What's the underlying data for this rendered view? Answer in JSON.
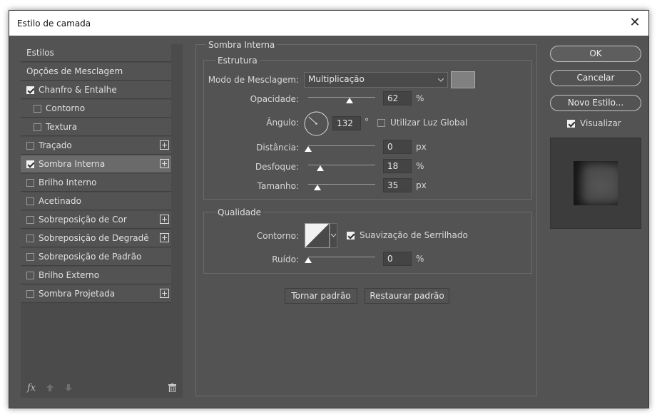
{
  "window": {
    "title": "Estilo de camada",
    "close_symbol": "✕"
  },
  "styles_list": {
    "items": [
      {
        "label": "Estilos",
        "checkbox": false,
        "checked": false,
        "plus": false,
        "indent": false,
        "selected": false
      },
      {
        "label": "Opções de Mesclagem",
        "checkbox": false,
        "checked": false,
        "plus": false,
        "indent": false,
        "selected": false
      },
      {
        "label": "Chanfro & Entalhe",
        "checkbox": true,
        "checked": true,
        "plus": false,
        "indent": false,
        "selected": false
      },
      {
        "label": "Contorno",
        "checkbox": true,
        "checked": false,
        "plus": false,
        "indent": true,
        "selected": false
      },
      {
        "label": "Textura",
        "checkbox": true,
        "checked": false,
        "plus": false,
        "indent": true,
        "selected": false
      },
      {
        "label": "Traçado",
        "checkbox": true,
        "checked": false,
        "plus": true,
        "indent": false,
        "selected": false
      },
      {
        "label": "Sombra Interna",
        "checkbox": true,
        "checked": true,
        "plus": true,
        "indent": false,
        "selected": true
      },
      {
        "label": "Brilho Interno",
        "checkbox": true,
        "checked": false,
        "plus": false,
        "indent": false,
        "selected": false
      },
      {
        "label": "Acetinado",
        "checkbox": true,
        "checked": false,
        "plus": false,
        "indent": false,
        "selected": false
      },
      {
        "label": "Sobreposição de Cor",
        "checkbox": true,
        "checked": false,
        "plus": true,
        "indent": false,
        "selected": false
      },
      {
        "label": "Sobreposição de Degradê",
        "checkbox": true,
        "checked": false,
        "plus": true,
        "indent": false,
        "selected": false
      },
      {
        "label": "Sobreposição de Padrão",
        "checkbox": true,
        "checked": false,
        "plus": false,
        "indent": false,
        "selected": false
      },
      {
        "label": "Brilho Externo",
        "checkbox": true,
        "checked": false,
        "plus": false,
        "indent": false,
        "selected": false
      },
      {
        "label": "Sombra Projetada",
        "checkbox": true,
        "checked": false,
        "plus": true,
        "indent": false,
        "selected": false
      }
    ],
    "footer_icons": [
      "fx-icon",
      "move-up-icon",
      "move-down-icon",
      "trash-icon"
    ],
    "fx_label": "fx"
  },
  "inner_shadow": {
    "title": "Sombra Interna",
    "structure": {
      "title": "Estrutura",
      "blend_mode_label": "Modo de Mesclagem:",
      "blend_mode_value": "Multiplicação",
      "shadow_color": "#808080",
      "opacity_label": "Opacidade:",
      "opacity_value": "62",
      "opacity_unit": "%",
      "angle_label": "Ângulo:",
      "angle_value": "132",
      "angle_unit": "°",
      "use_global_light_label": "Utilizar Luz Global",
      "use_global_light_checked": false,
      "distance_label": "Distância:",
      "distance_value": "0",
      "distance_unit": "px",
      "choke_label": "Desfoque:",
      "choke_value": "18",
      "choke_unit": "%",
      "size_label": "Tamanho:",
      "size_value": "35",
      "size_unit": "px"
    },
    "quality": {
      "title": "Qualidade",
      "contour_label": "Contorno:",
      "anti_alias_label": "Suavização de Serrilhado",
      "anti_alias_checked": true,
      "noise_label": "Ruído:",
      "noise_value": "0",
      "noise_unit": "%"
    },
    "make_default_label": "Tornar padrão",
    "reset_default_label": "Restaurar padrão"
  },
  "sliders": {
    "opacity": 0.62,
    "distance": 0.0,
    "choke": 0.18,
    "size": 0.14,
    "noise": 0.0
  },
  "actions": {
    "ok_label": "OK",
    "cancel_label": "Cancelar",
    "new_style_label": "Novo Estilo...",
    "preview_label": "Visualizar",
    "preview_checked": true
  },
  "colors": {
    "dialog_bg": "#535353",
    "selected_row": "#6a6a6a",
    "preview_bg": "#3c3c3c"
  }
}
